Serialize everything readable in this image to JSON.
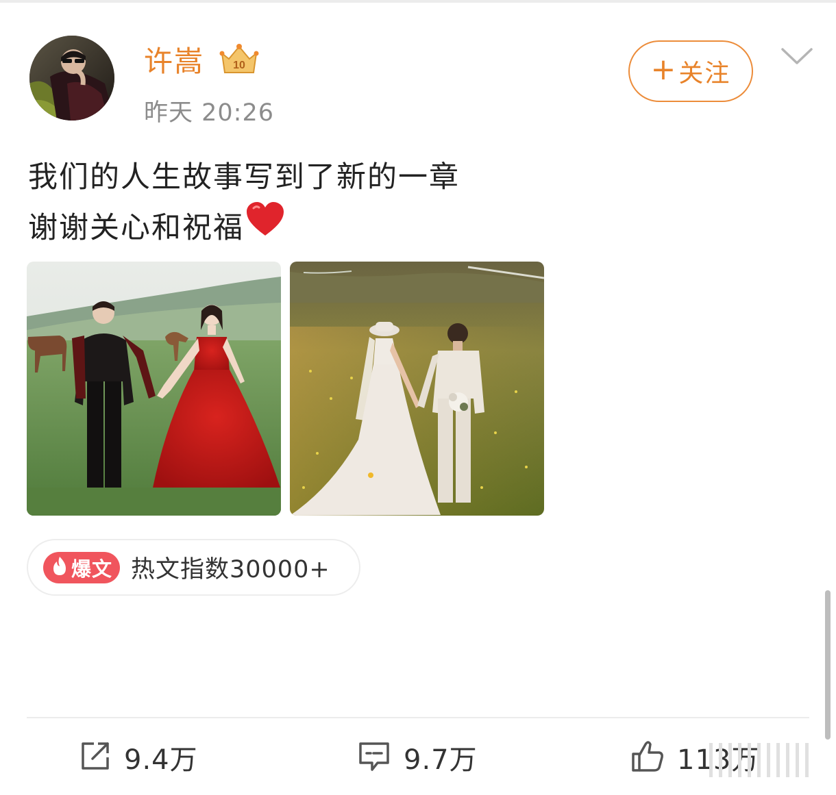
{
  "post": {
    "author": {
      "name": "许嵩",
      "badge_icon": "vip-crown-icon",
      "avatar_icon": "avatar-photo"
    },
    "timestamp": "昨天 20:26",
    "follow": {
      "plus": "+",
      "label": "关注"
    },
    "menu_icon": "chevron-down-icon",
    "text_lines": [
      "我们的人生故事写到了新的一章",
      "谢谢关心和祝福"
    ],
    "emoji": "red-heart-icon",
    "photos": [
      {
        "icon": "photo-couple-red-dress"
      },
      {
        "icon": "photo-couple-white-gown"
      }
    ],
    "hot_tag": {
      "badge": "爆文",
      "text": "热文指数30000+"
    }
  },
  "actions": {
    "share": {
      "icon": "share-icon",
      "count": "9.4万"
    },
    "comment": {
      "icon": "comment-icon",
      "count": "9.7万"
    },
    "like": {
      "icon": "thumbs-up-icon",
      "count": "113万"
    }
  },
  "colors": {
    "accent": "#e8832a",
    "hot_badge": "#f0555d",
    "muted_text": "#8c8c8c"
  }
}
